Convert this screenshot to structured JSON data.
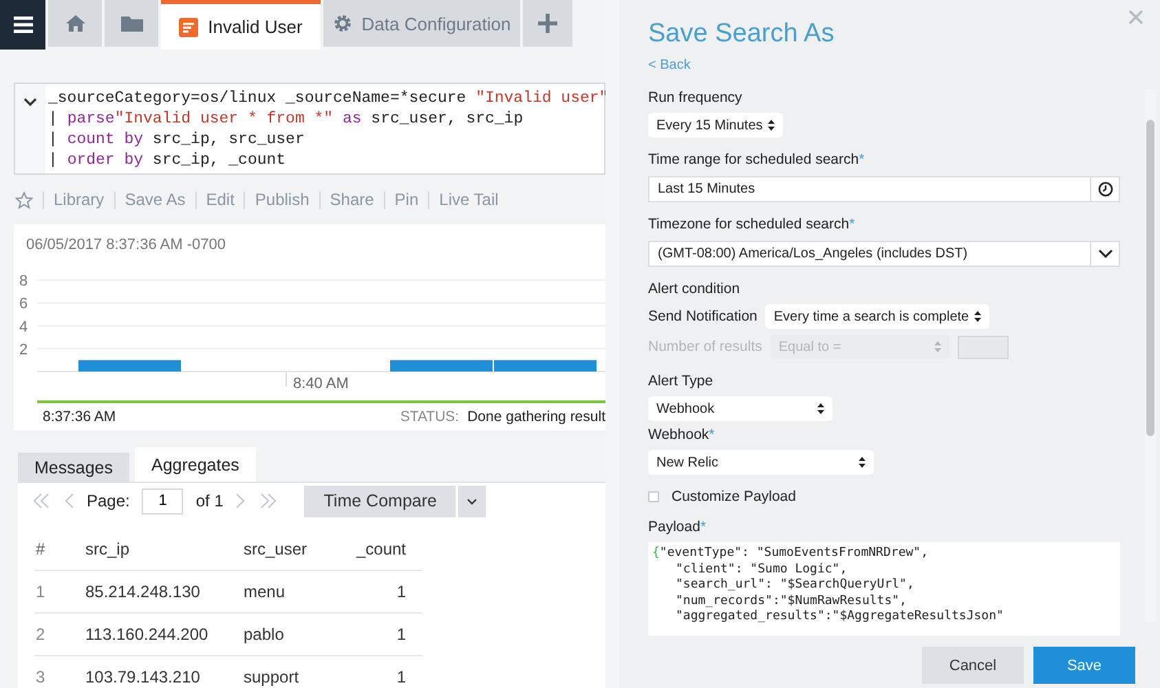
{
  "tabs": [
    {
      "kind": "home",
      "selected": false
    },
    {
      "kind": "folder",
      "selected": false
    },
    {
      "kind": "search",
      "label": "Invalid User",
      "selected": true
    },
    {
      "kind": "config",
      "label": "Data Configuration",
      "selected": false
    },
    {
      "kind": "add",
      "selected": false
    }
  ],
  "query": {
    "lines": [
      [
        {
          "text": "_sourceCategory=os/linux _sourceName=*secure ",
          "kind": "plain"
        },
        {
          "text": "\"Invalid user\"",
          "kind": "string"
        }
      ],
      [
        {
          "text": "| ",
          "kind": "plain"
        },
        {
          "text": "parse",
          "kind": "keyword"
        },
        {
          "text": "\"Invalid user * from *\"",
          "kind": "string"
        },
        {
          "text": " as",
          "kind": "keyword"
        },
        {
          "text": " src_user, src_ip",
          "kind": "plain"
        }
      ],
      [
        {
          "text": "| ",
          "kind": "plain"
        },
        {
          "text": "count by",
          "kind": "keyword"
        },
        {
          "text": " src_ip, src_user",
          "kind": "plain"
        }
      ],
      [
        {
          "text": "| ",
          "kind": "plain"
        },
        {
          "text": "order by",
          "kind": "keyword"
        },
        {
          "text": " src_ip, _count",
          "kind": "plain"
        }
      ]
    ]
  },
  "toolbar": [
    "Library",
    "Save As",
    "Edit",
    "Publish",
    "Share",
    "Pin",
    "Live Tail"
  ],
  "histogram": {
    "timestamp": "06/05/2017 8:37:36 AM -0700",
    "chart_data": {
      "type": "bar",
      "categories": [
        null,
        null,
        "8:40 AM",
        null,
        null
      ],
      "values": [
        1,
        0,
        0,
        1,
        1
      ],
      "ylim": [
        0,
        8
      ],
      "yticks": [
        2,
        4,
        6,
        8
      ],
      "grid": true
    },
    "start_time": "8:37:36 AM",
    "status_label": "STATUS:",
    "status": "Done gathering result"
  },
  "results": {
    "tabs": [
      {
        "label": "Messages",
        "selected": false
      },
      {
        "label": "Aggregates",
        "selected": true
      }
    ],
    "pager": {
      "page_label": "Page:",
      "page": "1",
      "of": "of 1"
    },
    "time_compare": "Time Compare",
    "columns": [
      "#",
      "src_ip",
      "src_user",
      "_count"
    ],
    "rows": [
      [
        "1",
        "85.214.248.130",
        "menu",
        "1"
      ],
      [
        "2",
        "113.160.244.200",
        "pablo",
        "1"
      ],
      [
        "3",
        "103.79.143.210",
        "support",
        "1"
      ]
    ]
  },
  "dialog": {
    "title": "Save Search As",
    "back": "< Back",
    "run_frequency": {
      "label": "Run frequency",
      "value": "Every 15 Minutes"
    },
    "time_range": {
      "label": "Time range for scheduled search",
      "mark": "*",
      "value": "Last 15 Minutes"
    },
    "timezone": {
      "label": "Timezone for scheduled search",
      "mark": "*",
      "value": "(GMT-08:00) America/Los_Angeles (includes DST)"
    },
    "alert_condition": "Alert condition",
    "send_notification": {
      "label": "Send Notification",
      "value": "Every time a search is complete"
    },
    "number_of_results": {
      "label": "Number of results",
      "value": "Equal to =",
      "disabled": true
    },
    "alert_type": {
      "label": "Alert Type",
      "value": "Webhook"
    },
    "webhook": {
      "label": "Webhook",
      "mark": "*",
      "value": "New Relic"
    },
    "customize_payload": {
      "label": "Customize Payload",
      "checked": false
    },
    "payload": {
      "label": "Payload",
      "mark": "*",
      "brace": "{",
      "lines": [
        "\"eventType\": \"SumoEventsFromNRDrew\",",
        "\"client\": \"Sumo Logic\",",
        "\"search_url\": \"$SearchQueryUrl\",",
        "\"num_records\":\"$NumRawResults\",",
        "\"aggregated_results\":\"$AggregateResultsJson\""
      ]
    },
    "cancel": "Cancel",
    "save": "Save"
  }
}
